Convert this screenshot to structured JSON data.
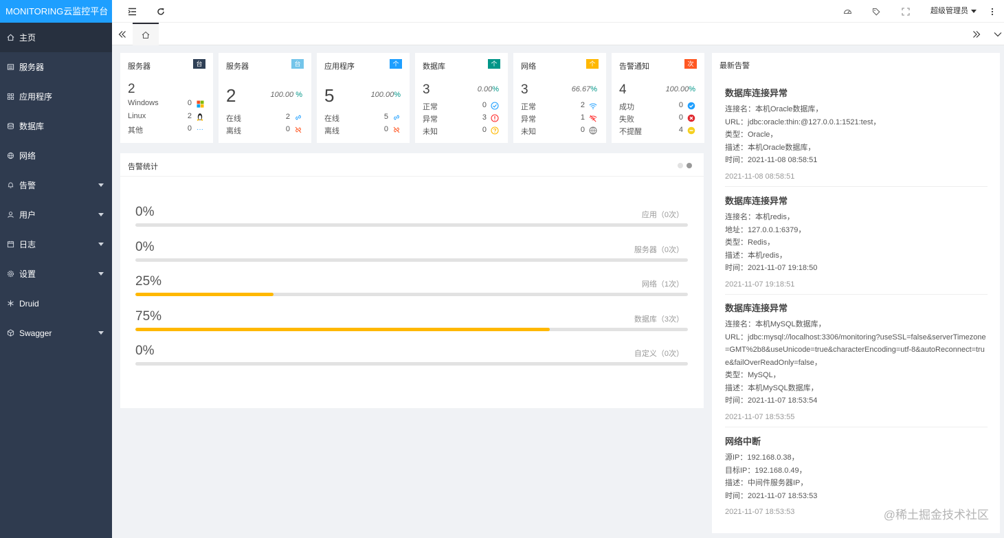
{
  "app": {
    "title": "MONITORING云监控平台"
  },
  "sidebar": {
    "items": [
      {
        "label": "主页",
        "icon": "home-icon",
        "active": true,
        "expandable": false
      },
      {
        "label": "服务器",
        "icon": "server-icon",
        "expandable": false
      },
      {
        "label": "应用程序",
        "icon": "app-icon",
        "expandable": false
      },
      {
        "label": "数据库",
        "icon": "database-icon",
        "expandable": false
      },
      {
        "label": "网络",
        "icon": "network-icon",
        "expandable": false
      },
      {
        "label": "告警",
        "icon": "bell-icon",
        "expandable": true
      },
      {
        "label": "用户",
        "icon": "user-icon",
        "expandable": true
      },
      {
        "label": "日志",
        "icon": "log-icon",
        "expandable": true
      },
      {
        "label": "设置",
        "icon": "gear-icon",
        "expandable": true
      },
      {
        "label": "Druid",
        "icon": "druid-icon",
        "expandable": false
      },
      {
        "label": "Swagger",
        "icon": "swagger-icon",
        "expandable": true
      }
    ]
  },
  "header": {
    "user": "超级管理员"
  },
  "cards": [
    {
      "title": "服务器",
      "badge": "台",
      "badge_color": "#2f4056",
      "count": "2",
      "rows": [
        {
          "label": "Windows",
          "value": "0",
          "icon": "windows-icon"
        },
        {
          "label": "Linux",
          "value": "2",
          "icon": "linux-icon"
        },
        {
          "label": "其他",
          "value": "0",
          "icon": "more-icon"
        }
      ]
    },
    {
      "title": "服务器",
      "badge": "台",
      "badge_color": "#74c5ea",
      "count": "2",
      "percent": "100.00",
      "percent_sign": "%",
      "rows": [
        {
          "label": "在线",
          "value": "2",
          "icon": "link-icon"
        },
        {
          "label": "离线",
          "value": "0",
          "icon": "unlink-icon"
        }
      ]
    },
    {
      "title": "应用程序",
      "badge": "个",
      "badge_color": "#1e9fff",
      "count": "5",
      "percent": "100.00",
      "percent_sign": "%",
      "rows": [
        {
          "label": "在线",
          "value": "5",
          "icon": "link-icon"
        },
        {
          "label": "离线",
          "value": "0",
          "icon": "unlink-icon"
        }
      ]
    },
    {
      "title": "数据库",
      "badge": "个",
      "badge_color": "#009688",
      "count": "3",
      "percent": "0.00",
      "percent_sign": "%",
      "rows": [
        {
          "label": "正常",
          "value": "0",
          "icon": "check-circle-icon"
        },
        {
          "label": "异常",
          "value": "3",
          "icon": "warning-circle-icon"
        },
        {
          "label": "未知",
          "value": "0",
          "icon": "question-circle-icon"
        }
      ]
    },
    {
      "title": "网络",
      "badge": "个",
      "badge_color": "#ffb800",
      "count": "3",
      "percent": "66.67",
      "percent_sign": "%",
      "rows": [
        {
          "label": "正常",
          "value": "2",
          "icon": "wifi-icon"
        },
        {
          "label": "异常",
          "value": "1",
          "icon": "wifi-off-icon"
        },
        {
          "label": "未知",
          "value": "0",
          "icon": "globe-icon"
        }
      ]
    },
    {
      "title": "告警通知",
      "badge": "次",
      "badge_color": "#ff5722",
      "count": "4",
      "percent": "100.00",
      "percent_sign": "%",
      "rows": [
        {
          "label": "成功",
          "value": "0",
          "icon": "success-icon"
        },
        {
          "label": "失败",
          "value": "0",
          "icon": "fail-icon"
        },
        {
          "label": "不提醒",
          "value": "4",
          "icon": "mute-icon"
        }
      ]
    }
  ],
  "stats": {
    "title": "告警统计",
    "items": [
      {
        "value": "0%",
        "percent": 0,
        "label": "应用（0次）"
      },
      {
        "value": "0%",
        "percent": 0,
        "label": "服务器（0次）"
      },
      {
        "value": "25%",
        "percent": 25,
        "label": "网络（1次）"
      },
      {
        "value": "75%",
        "percent": 75,
        "label": "数据库（3次）"
      },
      {
        "value": "0%",
        "percent": 0,
        "label": "自定义（0次）"
      }
    ]
  },
  "alerts": {
    "title": "最新告警",
    "items": [
      {
        "title": "数据库连接异常",
        "lines": [
          "连接名：本机Oracle数据库，",
          "URL：jdbc:oracle:thin:@127.0.0.1:1521:test，",
          "类型：Oracle，",
          "描述：本机Oracle数据库，",
          "时间：2021-11-08 08:58:51"
        ],
        "time": "2021-11-08 08:58:51"
      },
      {
        "title": "数据库连接异常",
        "lines": [
          "连接名：本机redis，",
          "地址：127.0.0.1:6379，",
          "类型：Redis，",
          "描述：本机redis，",
          "时间：2021-11-07 19:18:50"
        ],
        "time": "2021-11-07 19:18:51"
      },
      {
        "title": "数据库连接异常",
        "lines": [
          "连接名：本机MySQL数据库，",
          "URL：jdbc:mysql://localhost:3306/monitoring?useSSL=false&serverTimezone=GMT%2b8&useUnicode=true&characterEncoding=utf-8&autoReconnect=true&failOverReadOnly=false，",
          "类型：MySQL，",
          "描述：本机MySQL数据库，",
          "时间：2021-11-07 18:53:54"
        ],
        "time": "2021-11-07 18:53:55"
      },
      {
        "title": "网络中断",
        "lines": [
          "源IP：192.168.0.38，",
          "目标IP：192.168.0.49，",
          "描述：中间件服务器IP，",
          "时间：2021-11-07 18:53:53"
        ],
        "time": "2021-11-07 18:53:53"
      }
    ]
  },
  "watermark": "@稀土掘金技术社区"
}
